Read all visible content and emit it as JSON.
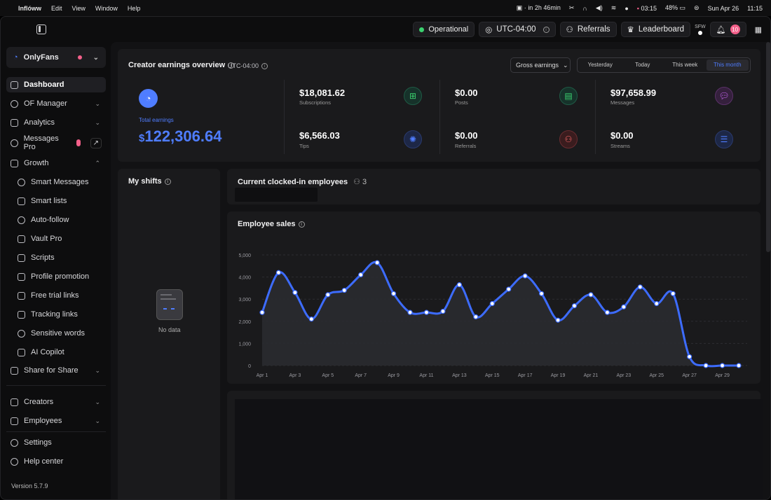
{
  "menubar": {
    "app_name": "Inflóww",
    "menus": [
      "Edit",
      "View",
      "Window",
      "Help"
    ],
    "timer": "in 2h 46min",
    "clock_small": "03:15",
    "battery": "48%",
    "date": "Sun Apr 26",
    "time": "11:15"
  },
  "topbar": {
    "status": "Operational",
    "timezone": "UTC-04:00",
    "referrals_label": "Referrals",
    "leaderboard_label": "Leaderboard",
    "sfw_label": "SFW",
    "notifications_count": "10"
  },
  "sidebar": {
    "account": "OnlyFans",
    "items": [
      {
        "label": "Dashboard"
      },
      {
        "label": "OF Manager"
      },
      {
        "label": "Analytics"
      },
      {
        "label": "Messages Pro"
      },
      {
        "label": "Growth"
      },
      {
        "label": "Smart Messages"
      },
      {
        "label": "Smart lists"
      },
      {
        "label": "Auto-follow"
      },
      {
        "label": "Vault Pro"
      },
      {
        "label": "Scripts"
      },
      {
        "label": "Profile promotion"
      },
      {
        "label": "Free trial links"
      },
      {
        "label": "Tracking links"
      },
      {
        "label": "Sensitive words"
      },
      {
        "label": "AI Copilot"
      },
      {
        "label": "Share for Share"
      },
      {
        "label": "Creators"
      },
      {
        "label": "Employees"
      },
      {
        "label": "Settings"
      },
      {
        "label": "Help center"
      }
    ],
    "version": "Version 5.7.9"
  },
  "overview": {
    "title": "Creator earnings overview",
    "timezone": "UTC-04:00",
    "dropdown": "Gross earnings",
    "ranges": [
      "Yesterday",
      "Today",
      "This week",
      "This month"
    ],
    "selected_range": "This month",
    "total_label": "Total earnings",
    "total_currency": "$",
    "total_value": "122,306.64",
    "metrics": [
      {
        "value": "$18,081.62",
        "label": "Subscriptions"
      },
      {
        "value": "$6,566.03",
        "label": "Tips"
      },
      {
        "value": "$0.00",
        "label": "Posts"
      },
      {
        "value": "$0.00",
        "label": "Referrals"
      },
      {
        "value": "$97,658.99",
        "label": "Messages"
      },
      {
        "value": "$0.00",
        "label": "Streams"
      }
    ]
  },
  "shifts": {
    "title": "My shifts",
    "empty_text": "No data"
  },
  "clocked": {
    "title": "Current clocked-in employees",
    "count": "3"
  },
  "sales": {
    "title": "Employee sales"
  },
  "colors": {
    "accent": "#4f7dff",
    "card": "#1a1a1c",
    "pink": "#f3608a",
    "green": "#3bd16f"
  },
  "chart_data": {
    "type": "area",
    "title": "Employee sales",
    "x_tick_labels": [
      "Apr 1",
      "Apr 3",
      "Apr 5",
      "Apr 7",
      "Apr 9",
      "Apr 11",
      "Apr 13",
      "Apr 15",
      "Apr 17",
      "Apr 19",
      "Apr 21",
      "Apr 23",
      "Apr 25",
      "Apr 27",
      "Apr 29"
    ],
    "x": [
      "Apr 1",
      "Apr 2",
      "Apr 3",
      "Apr 4",
      "Apr 5",
      "Apr 6",
      "Apr 7",
      "Apr 8",
      "Apr 9",
      "Apr 10",
      "Apr 11",
      "Apr 12",
      "Apr 13",
      "Apr 14",
      "Apr 15",
      "Apr 16",
      "Apr 17",
      "Apr 18",
      "Apr 19",
      "Apr 20",
      "Apr 21",
      "Apr 22",
      "Apr 23",
      "Apr 24",
      "Apr 25",
      "Apr 26",
      "Apr 27",
      "Apr 28",
      "Apr 29",
      "Apr 30"
    ],
    "values": [
      2400,
      4200,
      3300,
      2100,
      3200,
      3400,
      4100,
      4650,
      3250,
      2400,
      2400,
      2450,
      3650,
      2200,
      2800,
      3450,
      4050,
      3250,
      2050,
      2700,
      3200,
      2400,
      2650,
      3550,
      2800,
      3250,
      400,
      0,
      0,
      0
    ],
    "ylim": [
      0,
      5000
    ],
    "y_ticks": [
      "0",
      "1,000",
      "2,000",
      "3,000",
      "4,000",
      "5,000"
    ],
    "grid": true
  }
}
